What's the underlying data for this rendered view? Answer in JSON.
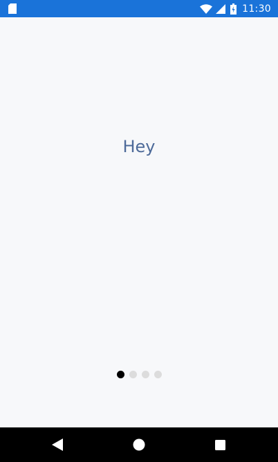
{
  "status_bar": {
    "time": "11:30",
    "color": "#1a73d9",
    "icons": [
      "sd-card-icon",
      "wifi-icon",
      "signal-icon",
      "battery-icon"
    ]
  },
  "main": {
    "greeting": "Hey",
    "text_color": "#4d6a99"
  },
  "page_indicator": {
    "total_pages": 4,
    "current_page": 1
  },
  "nav_bar": {
    "buttons": [
      "back-icon",
      "home-icon",
      "recents-icon"
    ]
  }
}
